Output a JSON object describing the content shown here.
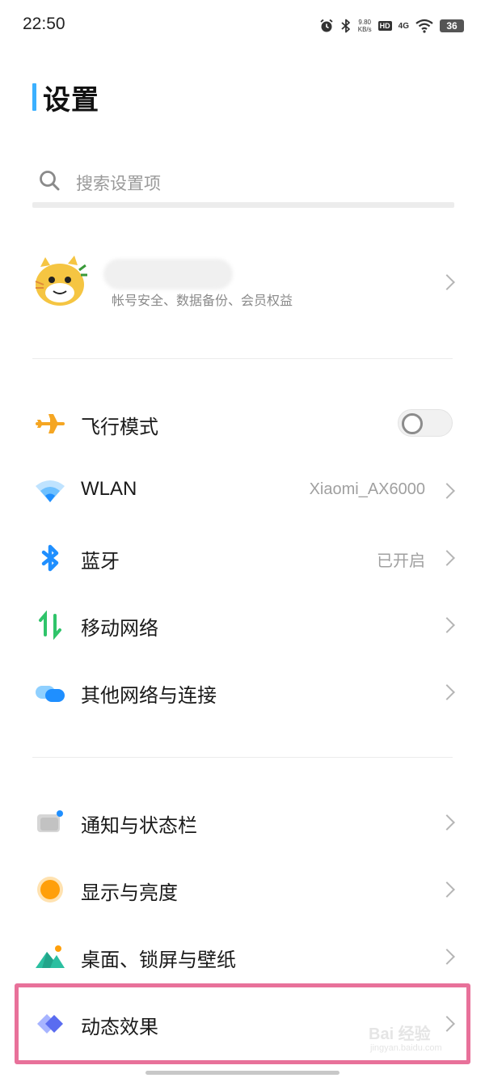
{
  "status_bar": {
    "time": "22:50",
    "net_speed_value": "9.80",
    "net_speed_unit": "KB/s",
    "hd_label": "HD",
    "signal_label": "4G",
    "battery": "36",
    "icons": [
      "alarm-icon",
      "bluetooth-icon",
      "hd-icon",
      "signal-4g-icon",
      "wifi-icon",
      "battery-icon"
    ]
  },
  "header": {
    "title": "设置",
    "accent_color": "#3bb0ff"
  },
  "search": {
    "placeholder": "搜索设置项"
  },
  "account": {
    "subtitle": "帐号安全、数据备份、会员权益"
  },
  "section_network": {
    "airplane": {
      "label": "飞行模式",
      "toggle_on": false,
      "icon": "airplane-icon"
    },
    "wlan": {
      "label": "WLAN",
      "value": "Xiaomi_AX6000",
      "icon": "wifi-icon"
    },
    "bluetooth": {
      "label": "蓝牙",
      "value": "已开启",
      "icon": "bluetooth-icon"
    },
    "mobile": {
      "label": "移动网络",
      "icon": "mobile-data-icon"
    },
    "other": {
      "label": "其他网络与连接",
      "icon": "connection-icon"
    }
  },
  "section_display": {
    "notification": {
      "label": "通知与状态栏",
      "icon": "notification-icon"
    },
    "display": {
      "label": "显示与亮度",
      "icon": "brightness-icon"
    },
    "wallpaper": {
      "label": "桌面、锁屏与壁纸",
      "icon": "wallpaper-icon"
    },
    "animation": {
      "label": "动态效果",
      "icon": "animation-icon"
    }
  },
  "highlight_color": "#e8719a",
  "watermark": {
    "text": "Bai 经验",
    "url": "jingyan.baidu.com"
  }
}
